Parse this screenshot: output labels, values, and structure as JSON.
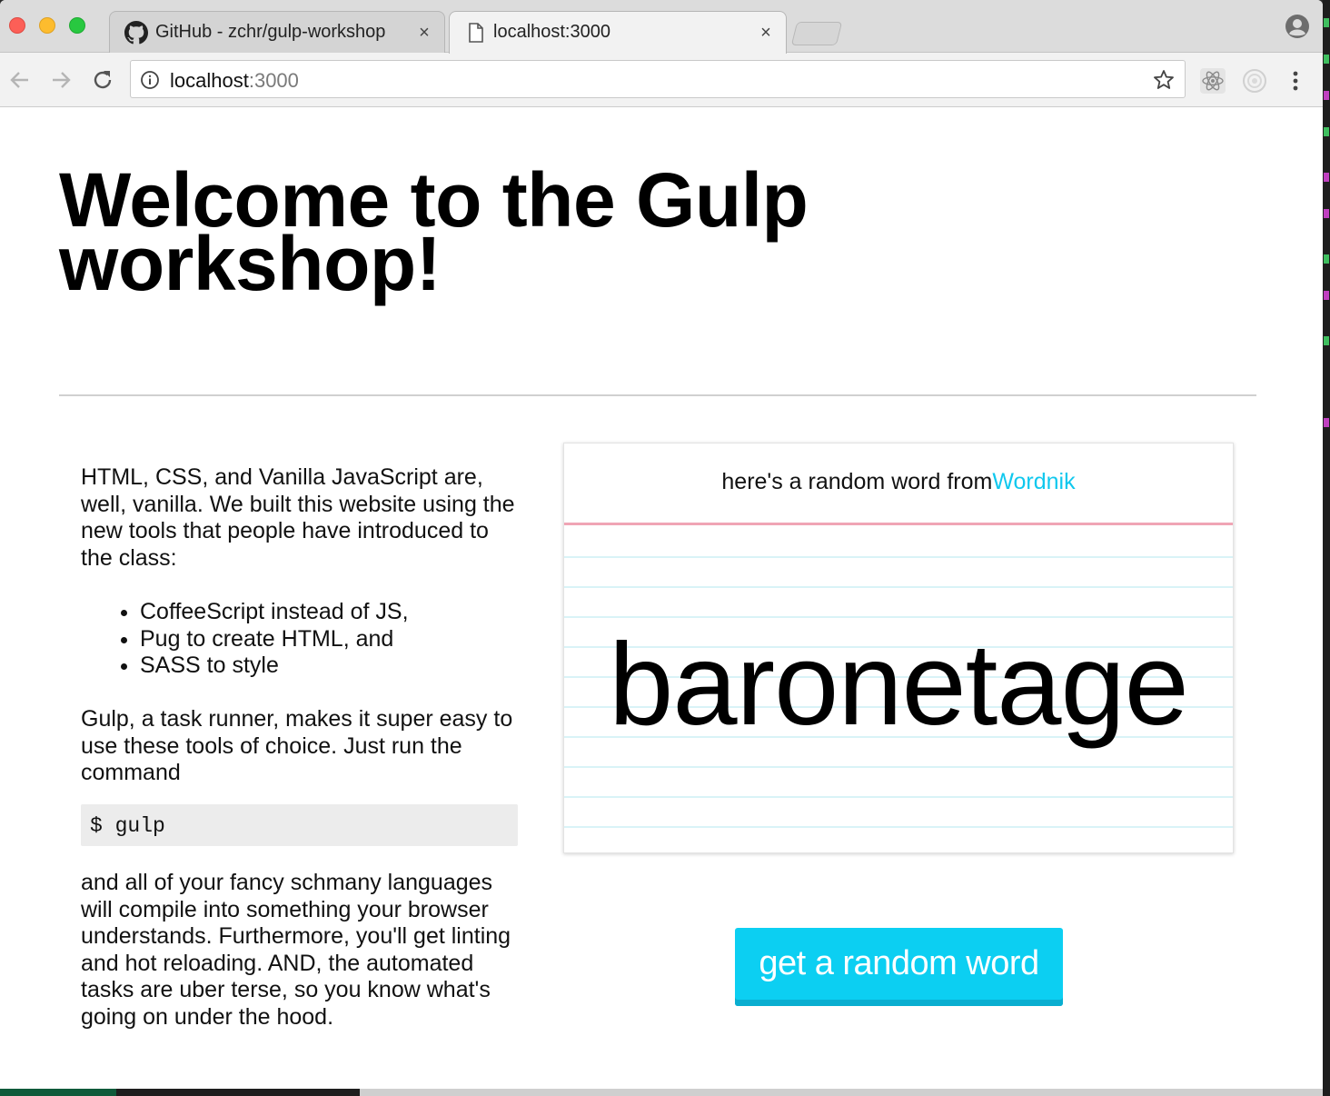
{
  "browser": {
    "tabs": [
      {
        "title": "GitHub - zchr/gulp-workshop",
        "icon": "github-icon",
        "close": "×"
      },
      {
        "title": "localhost:3000",
        "icon": "page-icon",
        "close": "×"
      }
    ],
    "url_host": "localhost",
    "url_port": ":3000",
    "toolbar_icons": [
      "back-arrow-icon",
      "forward-arrow-icon",
      "reload-icon",
      "info-icon",
      "star-icon",
      "react-devtools-icon",
      "extension-circle-icon",
      "menu-icon",
      "profile-icon"
    ]
  },
  "page": {
    "title": "Welcome to the Gulp workshop!",
    "intro": "HTML, CSS, and Vanilla JavaScript are, well, vanilla. We built this website using the new tools that people have introduced to the class:",
    "tools": [
      "CoffeeScript instead of JS,",
      "Pug to create HTML, and",
      "SASS to style"
    ],
    "gulp_text": "Gulp, a task runner, makes it super easy to use these tools of choice. Just run the command",
    "command": "$ gulp",
    "outro": "and all of your fancy schmany languages will compile into something your browser understands. Furthermore, you'll get linting and hot reloading. AND, the automated tasks are uber terse, so you know what's going on under the hood.",
    "card": {
      "header_prefix": "here's a random word from",
      "header_link": "Wordnik",
      "word": "baronetage"
    },
    "button_label": "get a random word"
  },
  "colors": {
    "accent": "#0ccff2",
    "link": "#10c8ee",
    "card_rule": "#f0a5b5"
  }
}
